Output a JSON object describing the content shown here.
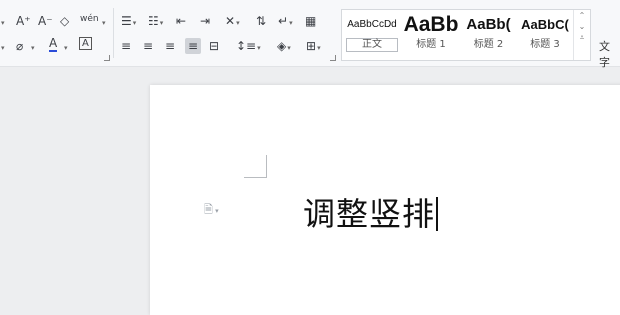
{
  "toolbar": {
    "font_group": {
      "grow_font": "A⁺",
      "shrink_font": "A⁻",
      "clear_format": "◇",
      "phonetic": "wén",
      "highlight": "⌀",
      "font_color": "A",
      "char_border": "A"
    },
    "paragraph_group": {
      "bullets": "☰",
      "numbering": "☷",
      "decrease_indent": "⇤",
      "increase_indent": "⇥",
      "chinese_layout": "✕",
      "sort": "⇅",
      "show_marks": "↵",
      "table_insert": "▦",
      "align_left": "≡",
      "align_center": "≡",
      "align_right": "≡",
      "justify": "≡",
      "distribute": "⊟",
      "line_spacing": "↕≡",
      "shading": "◈",
      "borders": "⊞"
    },
    "styles": [
      {
        "preview": "AaBbCcDd",
        "name": "正文"
      },
      {
        "preview": "AaBb",
        "name": "标题 1"
      },
      {
        "preview": "AaBb(",
        "name": "标题 2"
      },
      {
        "preview": "AaBbC(",
        "name": "标题 3"
      }
    ],
    "text_tool_label": "文字"
  },
  "document": {
    "text": "调整竖排"
  }
}
